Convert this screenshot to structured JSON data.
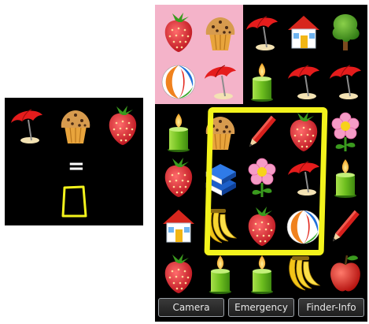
{
  "left_panel": {
    "clue_icons": [
      "umbrella-icon",
      "muffin-icon",
      "strawberry-icon"
    ],
    "equals_sign": "=",
    "answer_slot": "empty"
  },
  "right_panel": {
    "grid": [
      [
        "strawberry-icon",
        "muffin-icon",
        "umbrella-icon",
        "house-icon",
        "tree-icon"
      ],
      [
        "beach-ball-icon",
        "umbrella-icon",
        "candle-icon",
        "umbrella-icon",
        "umbrella-icon"
      ],
      [
        "candle-icon",
        "muffin-icon",
        "pencil-icon",
        "strawberry-icon",
        "flower-icon"
      ],
      [
        "strawberry-icon",
        "book-icon",
        "flower-icon",
        "umbrella-icon",
        "candle-icon"
      ],
      [
        "house-icon",
        "bananas-icon",
        "strawberry-icon",
        "beach-ball-icon",
        "pencil-icon"
      ],
      [
        "strawberry-icon",
        "candle-icon",
        "candle-icon",
        "bananas-icon",
        "apple-icon"
      ]
    ],
    "highlight_color": "#f4b3c9",
    "selection_color": "#f3f31c"
  },
  "buttons": {
    "camera": "Camera",
    "emergency": "Emergency",
    "finder_info": "Finder-Info"
  }
}
